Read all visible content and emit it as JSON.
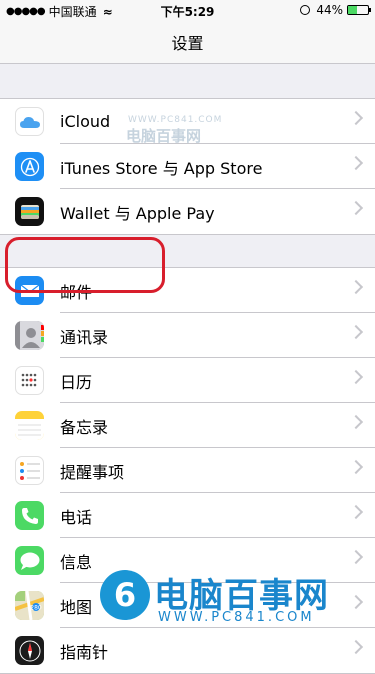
{
  "status_bar": {
    "signal_dots": "●●●●●",
    "carrier": "中国联通",
    "wifi_glyph": "≈",
    "time": "下午5:29",
    "battery": "44%",
    "battery_level": 0.44
  },
  "nav": {
    "title": "设置"
  },
  "groups": [
    {
      "rows": [
        {
          "label": "iCloud",
          "icon": "icloud-icon"
        },
        {
          "label": "iTunes Store 与 App Store",
          "icon": "app-store-icon"
        },
        {
          "label": "Wallet 与 Apple Pay",
          "icon": "wallet-icon"
        }
      ]
    },
    {
      "rows": [
        {
          "label": "邮件",
          "icon": "mail-icon"
        },
        {
          "label": "通讯录",
          "icon": "contacts-icon"
        },
        {
          "label": "日历",
          "icon": "calendar-icon"
        },
        {
          "label": "备忘录",
          "icon": "notes-icon"
        },
        {
          "label": "提醒事项",
          "icon": "reminders-icon"
        },
        {
          "label": "电话",
          "icon": "phone-icon"
        },
        {
          "label": "信息",
          "icon": "messages-icon"
        },
        {
          "label": "地图",
          "icon": "maps-icon"
        },
        {
          "label": "指南针",
          "icon": "compass-icon"
        }
      ]
    }
  ],
  "watermark": {
    "small_url": "WWW.PC841.COM",
    "small_name": "电脑百事网",
    "big_name": "电脑百事网",
    "big_url": "WWW.PC841.COM",
    "logo_glyph": "6"
  },
  "colors": {
    "highlight": "#d81e2c",
    "background": "#efeff4",
    "separator": "#c8c7cc",
    "chevron": "#c7c7cc"
  }
}
